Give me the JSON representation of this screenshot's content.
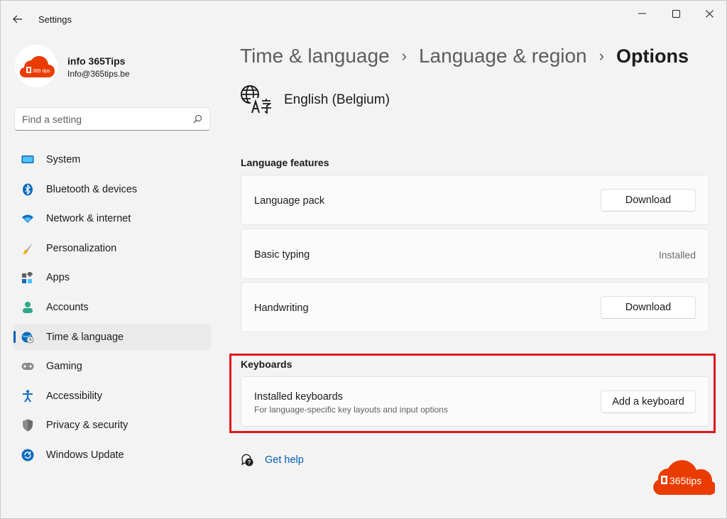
{
  "window": {
    "app_title": "Settings"
  },
  "profile": {
    "name": "info 365Tips",
    "email": "Info@365tips.be",
    "avatar_text": "365 tips"
  },
  "search": {
    "placeholder": "Find a setting"
  },
  "sidebar": {
    "items": [
      {
        "label": "System",
        "icon": "system-icon"
      },
      {
        "label": "Bluetooth & devices",
        "icon": "bluetooth-icon"
      },
      {
        "label": "Network & internet",
        "icon": "wifi-icon"
      },
      {
        "label": "Personalization",
        "icon": "paintbrush-icon"
      },
      {
        "label": "Apps",
        "icon": "apps-icon"
      },
      {
        "label": "Accounts",
        "icon": "accounts-icon"
      },
      {
        "label": "Time & language",
        "icon": "time-language-icon",
        "active": true
      },
      {
        "label": "Gaming",
        "icon": "gaming-icon"
      },
      {
        "label": "Accessibility",
        "icon": "accessibility-icon"
      },
      {
        "label": "Privacy & security",
        "icon": "shield-icon"
      },
      {
        "label": "Windows Update",
        "icon": "update-icon"
      }
    ]
  },
  "breadcrumb": {
    "part1": "Time & language",
    "part2": "Language & region",
    "current": "Options",
    "separator": "›"
  },
  "language": {
    "name": "English (Belgium)"
  },
  "features": {
    "title": "Language features",
    "language_pack": {
      "label": "Language pack",
      "button": "Download"
    },
    "basic_typing": {
      "label": "Basic typing",
      "status": "Installed"
    },
    "handwriting": {
      "label": "Handwriting",
      "button": "Download"
    }
  },
  "keyboards": {
    "title": "Keyboards",
    "installed": {
      "label": "Installed keyboards",
      "description": "For language-specific key layouts and input options",
      "button": "Add a keyboard"
    }
  },
  "help": {
    "label": "Get help"
  },
  "watermark": {
    "text": "365tips"
  },
  "colors": {
    "accent": "#005fb8",
    "highlight": "#e0171f",
    "brand_orange": "#eb3c00"
  }
}
